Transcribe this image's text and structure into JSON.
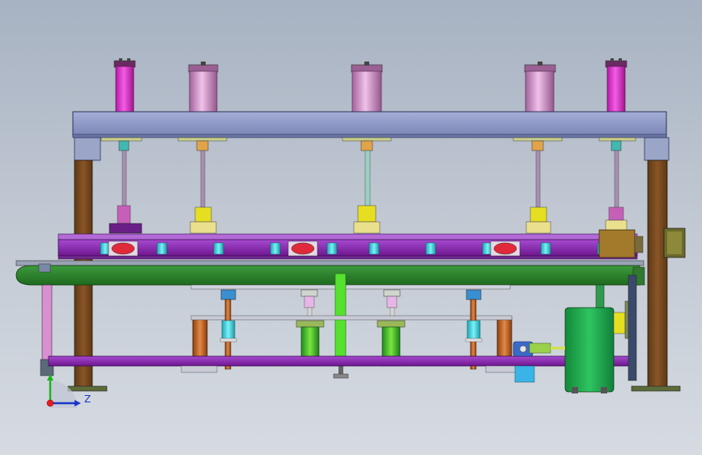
{
  "viewport": {
    "background_top": "#a7b2c2",
    "background_bottom": "#d6dbe2"
  },
  "triad": {
    "z_label": "Z",
    "x_color": "#e81c1c",
    "y_color": "#1db41d",
    "z_color": "#1a36c9"
  },
  "model_colors": {
    "top_beam": "#8e9ac4",
    "column": "#7a4a1f",
    "purple_rail": "#8a1fb3",
    "green_rail": "#2f8a2f",
    "cylinder_magenta": "#e23bd2",
    "cylinder_pink": "#d98fd0",
    "motor_green": "#1fa84d",
    "rod_bright_green": "#55e12e",
    "bearing_yellow": "#e6de20",
    "roller_cyan": "#3ad4e0",
    "copper": "#c86b2a"
  }
}
